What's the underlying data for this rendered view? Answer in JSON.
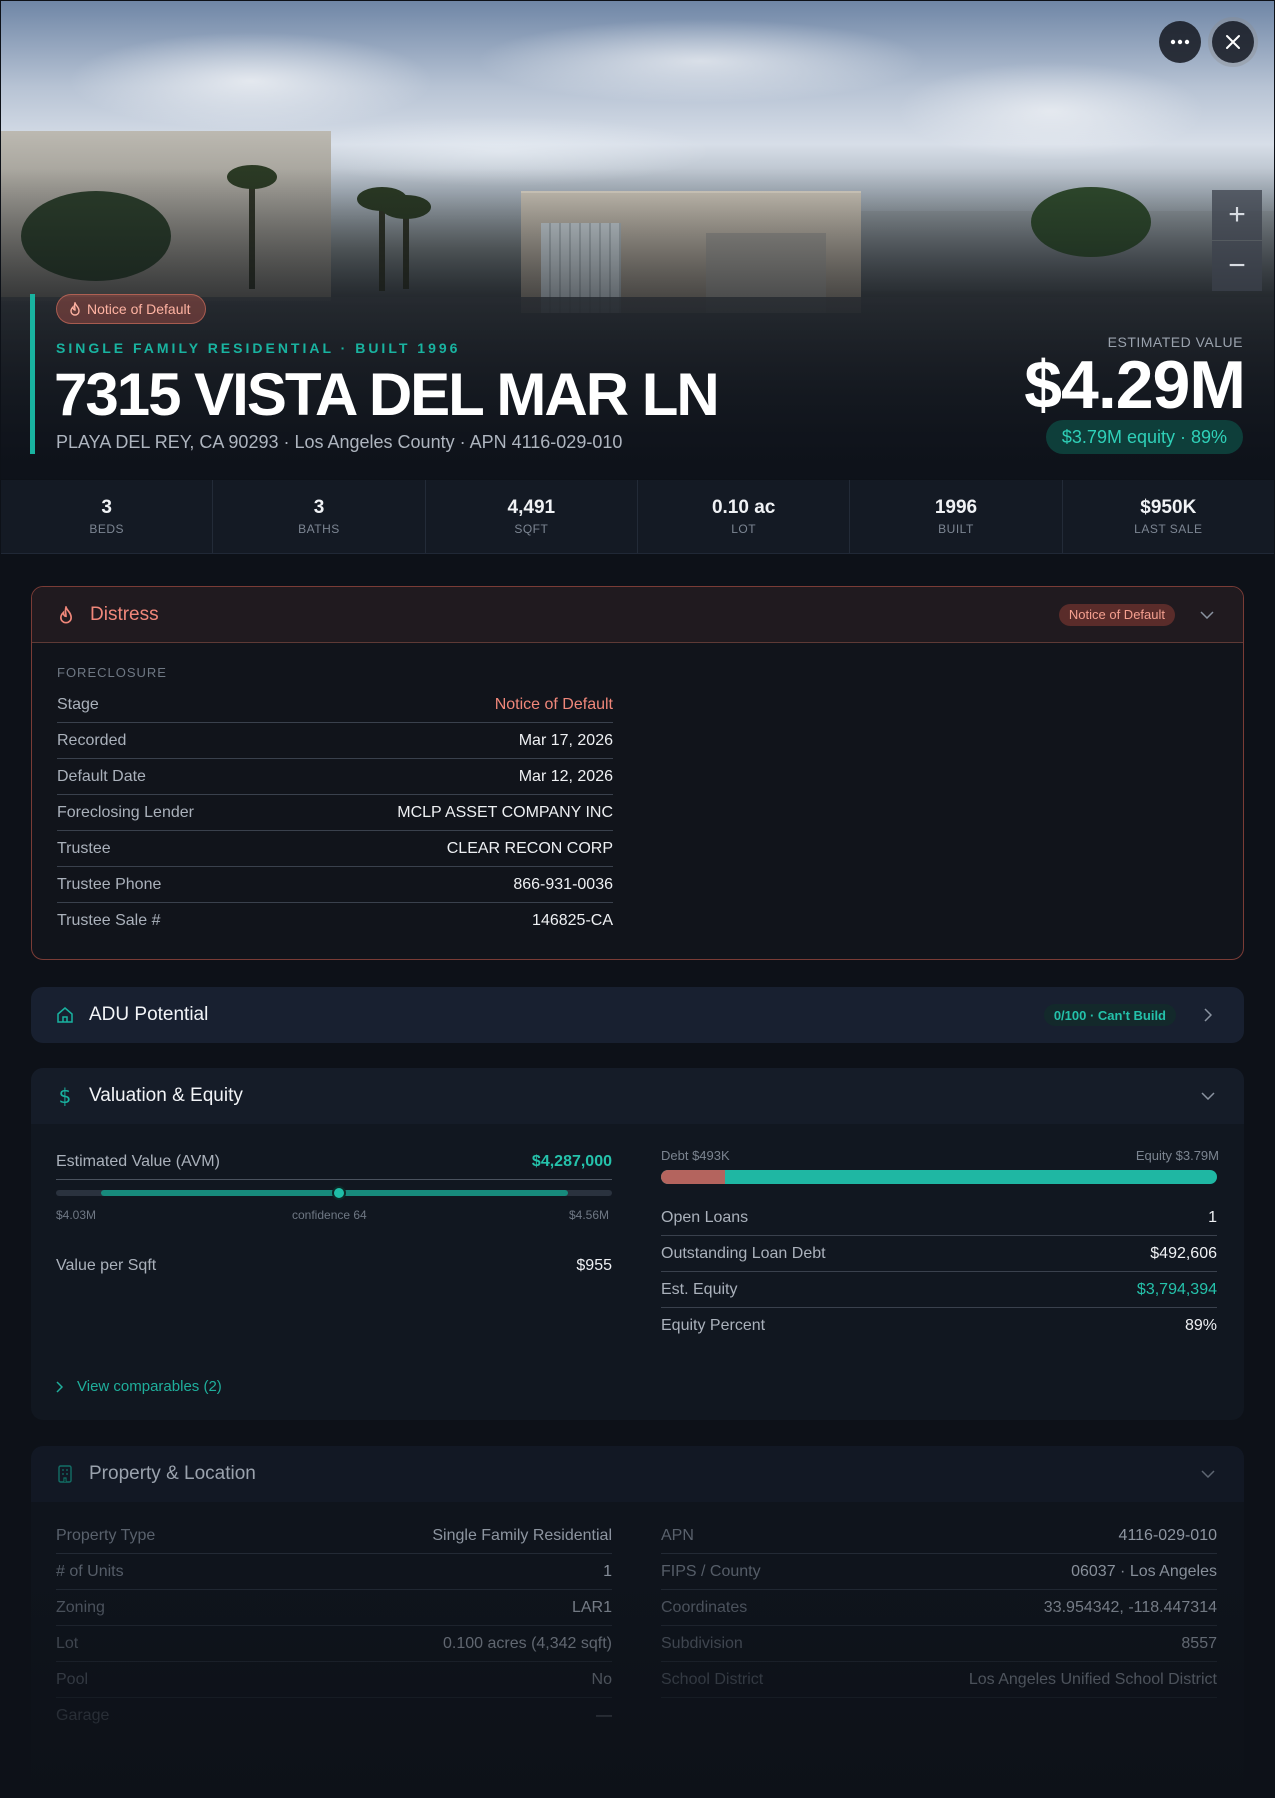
{
  "hero": {
    "status_badge": "Notice of Default",
    "eyebrow": "SINGLE FAMILY RESIDENTIAL · BUILT 1996",
    "title": "7315 VISTA DEL MAR LN",
    "subtitle": "PLAYA DEL REY, CA 90293 · Los Angeles County · APN 4116-029-010",
    "estimated_label": "ESTIMATED VALUE",
    "estimated_value": "$4.29M",
    "equity_pill": "$3.79M equity · 89%",
    "more_icon": "more-horizontal-icon",
    "close_icon": "close-icon",
    "zoom_in": "+",
    "zoom_out": "−"
  },
  "stats": [
    {
      "value": "3",
      "label": "BEDS"
    },
    {
      "value": "3",
      "label": "BATHS"
    },
    {
      "value": "4,491",
      "label": "SQFT"
    },
    {
      "value": "0.10 ac",
      "label": "LOT"
    },
    {
      "value": "1996",
      "label": "BUILT"
    },
    {
      "value": "$950K",
      "label": "LAST SALE"
    }
  ],
  "distress": {
    "title": "Distress",
    "badge": "Notice of Default",
    "section": "FORECLOSURE",
    "rows": [
      {
        "k": "Stage",
        "v": "Notice of Default"
      },
      {
        "k": "Recorded",
        "v": "Mar 17, 2026"
      },
      {
        "k": "Default Date",
        "v": "Mar 12, 2026"
      },
      {
        "k": "Foreclosing Lender",
        "v": "MCLP ASSET COMPANY INC"
      },
      {
        "k": "Trustee",
        "v": "CLEAR RECON CORP"
      },
      {
        "k": "Trustee Phone",
        "v": "866-931-0036"
      },
      {
        "k": "Trustee Sale #",
        "v": "146825-CA"
      }
    ]
  },
  "adu": {
    "title": "ADU Potential",
    "badge": "0/100 · Can't Build"
  },
  "valuation": {
    "title": "Valuation & Equity",
    "avm_label": "Estimated Value (AVM)",
    "avm_value": "$4,287,000",
    "range_low": "$4.03M",
    "range_mid": "confidence 64",
    "range_high": "$4.56M",
    "ppsf_label": "Value per Sqft",
    "ppsf_value": "$955",
    "debt_label": "Debt $493K",
    "equity_label": "Equity $3.79M",
    "debt_fraction": 0.115,
    "rows": [
      {
        "k": "Open Loans",
        "v": "1"
      },
      {
        "k": "Outstanding Loan Debt",
        "v": "$492,606"
      },
      {
        "k": "Est. Equity",
        "v": "$3,794,394"
      },
      {
        "k": "Equity Percent",
        "v": "89%"
      }
    ],
    "comps_link": "View comparables (2)"
  },
  "property": {
    "title": "Property & Location",
    "left": [
      {
        "k": "Property Type",
        "v": "Single Family Residential"
      },
      {
        "k": "# of Units",
        "v": "1"
      },
      {
        "k": "Zoning",
        "v": "LAR1"
      },
      {
        "k": "Lot",
        "v": "0.100 acres (4,342 sqft)"
      },
      {
        "k": "Pool",
        "v": "No"
      },
      {
        "k": "Garage",
        "v": "—"
      }
    ],
    "right": [
      {
        "k": "APN",
        "v": "4116-029-010"
      },
      {
        "k": "FIPS / County",
        "v": "06037 · Los Angeles"
      },
      {
        "k": "Coordinates",
        "v": "33.954342, -118.447314"
      },
      {
        "k": "Subdivision",
        "v": "8557"
      },
      {
        "k": "School District",
        "v": "Los Angeles Unified School District"
      }
    ]
  },
  "colors": {
    "accent": "#19b3a0",
    "distress": "#f0877a",
    "debt": "#b4645e"
  }
}
